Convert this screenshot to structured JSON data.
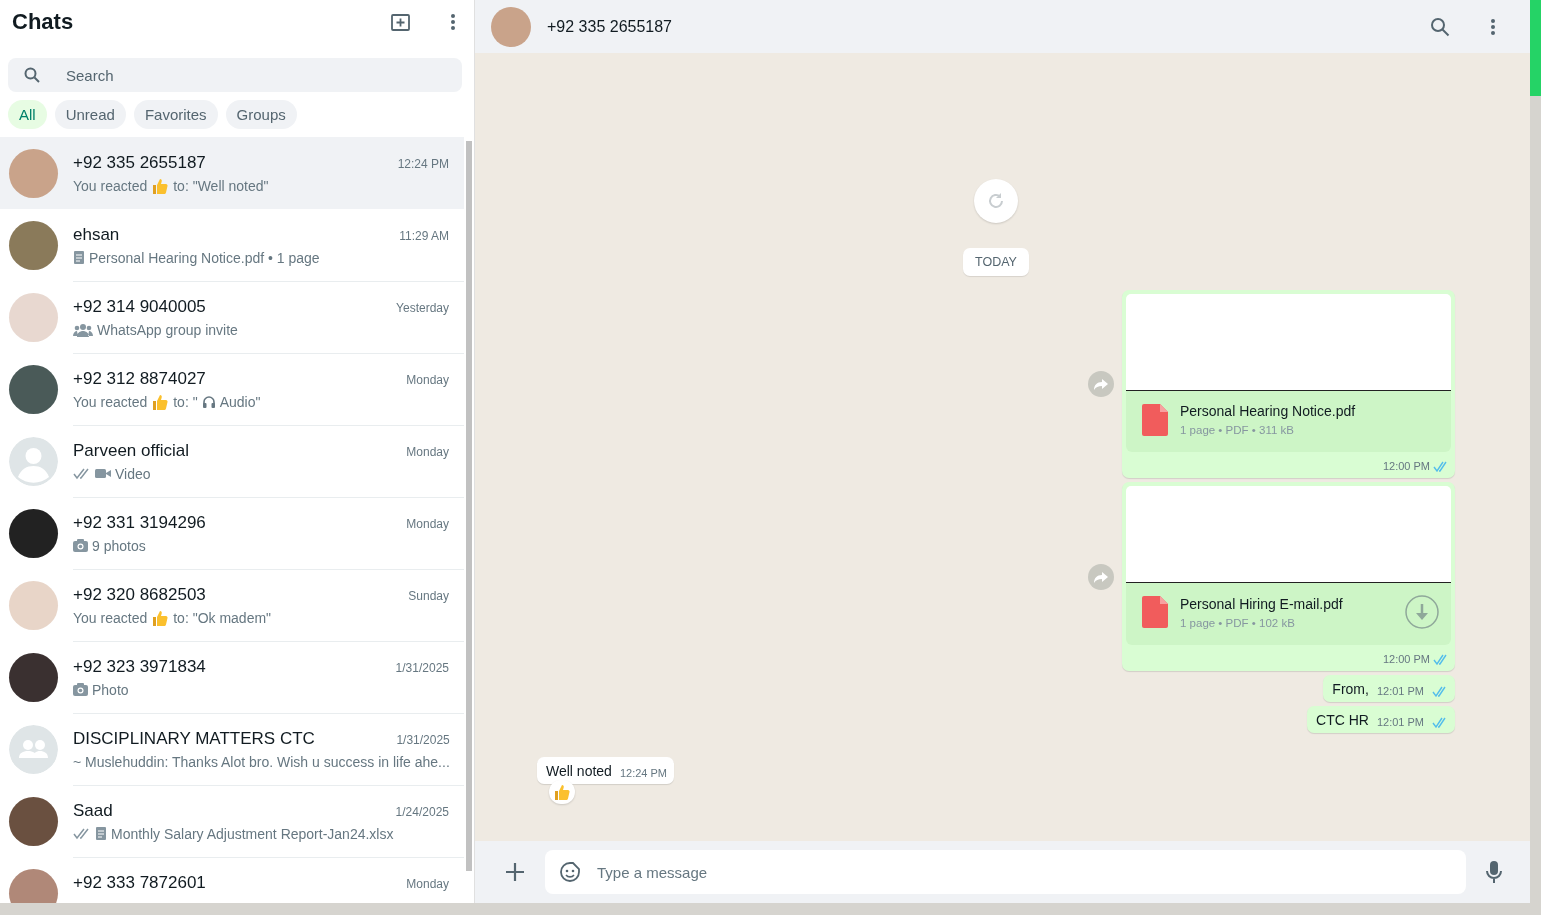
{
  "sidebar": {
    "title": "Chats",
    "search": {
      "placeholder": "Search"
    },
    "filters": [
      {
        "label": "All",
        "selected": true
      },
      {
        "label": "Unread",
        "selected": false
      },
      {
        "label": "Favorites",
        "selected": false
      },
      {
        "label": "Groups",
        "selected": false
      }
    ],
    "chats": [
      {
        "name": "+92 335 2655187",
        "time": "12:24 PM",
        "selected": true,
        "avatar": {
          "kind": "photo"
        },
        "preview": [
          {
            "kind": "text",
            "text": "You reacted"
          },
          {
            "kind": "thumbs"
          },
          {
            "kind": "text",
            "text": "to: \"Well noted\""
          }
        ]
      },
      {
        "name": "ehsan",
        "time": "11:29 AM",
        "selected": false,
        "avatar": {
          "kind": "photo"
        },
        "preview": [
          {
            "kind": "doc"
          },
          {
            "kind": "text",
            "text": "Personal Hearing Notice.pdf • 1 page"
          }
        ]
      },
      {
        "name": "+92 314 9040005",
        "time": "Yesterday",
        "selected": false,
        "avatar": {
          "kind": "photo"
        },
        "preview": [
          {
            "kind": "group"
          },
          {
            "kind": "text",
            "text": "WhatsApp group invite"
          }
        ]
      },
      {
        "name": "+92 312 8874027",
        "time": "Monday",
        "selected": false,
        "avatar": {
          "kind": "photo"
        },
        "preview": [
          {
            "kind": "text",
            "text": "You reacted"
          },
          {
            "kind": "thumbs"
          },
          {
            "kind": "text",
            "text": "to: \""
          },
          {
            "kind": "headphones"
          },
          {
            "kind": "text",
            "text": "Audio\""
          }
        ]
      },
      {
        "name": "Parveen official",
        "time": "Monday",
        "selected": false,
        "avatar": {
          "kind": "default"
        },
        "preview": [
          {
            "kind": "ticks"
          },
          {
            "kind": "video"
          },
          {
            "kind": "text",
            "text": "Video"
          }
        ]
      },
      {
        "name": "+92 331 3194296",
        "time": "Monday",
        "selected": false,
        "avatar": {
          "kind": "photo"
        },
        "preview": [
          {
            "kind": "camera"
          },
          {
            "kind": "text",
            "text": "9 photos"
          }
        ]
      },
      {
        "name": "+92 320 8682503",
        "time": "Sunday",
        "selected": false,
        "avatar": {
          "kind": "photo"
        },
        "preview": [
          {
            "kind": "text",
            "text": "You reacted"
          },
          {
            "kind": "thumbs"
          },
          {
            "kind": "text",
            "text": "to: \"Ok madem\""
          }
        ]
      },
      {
        "name": "+92 323 3971834",
        "time": "1/31/2025",
        "selected": false,
        "avatar": {
          "kind": "photo"
        },
        "preview": [
          {
            "kind": "camera"
          },
          {
            "kind": "text",
            "text": "Photo"
          }
        ]
      },
      {
        "name": "DISCIPLINARY MATTERS CTC",
        "time": "1/31/2025",
        "selected": false,
        "avatar": {
          "kind": "group"
        },
        "preview": [
          {
            "kind": "text",
            "text": "~ Muslehuddin: Thanks Alot bro. Wish u success in life ahe..."
          }
        ]
      },
      {
        "name": "Saad",
        "time": "1/24/2025",
        "selected": false,
        "avatar": {
          "kind": "photo"
        },
        "preview": [
          {
            "kind": "ticks"
          },
          {
            "kind": "doc"
          },
          {
            "kind": "text",
            "text": "Monthly Salary Adjustment Report-Jan24.xlsx"
          }
        ]
      },
      {
        "name": "+92 333 7872601",
        "time": "Monday",
        "selected": false,
        "avatar": {
          "kind": "photo"
        }
      }
    ]
  },
  "conversation": {
    "contact": "+92 335 2655187",
    "day": "TODAY",
    "messages": [
      {
        "kind": "document",
        "file": "Personal Hearing Notice.pdf",
        "meta": "1 page • PDF • 311 kB",
        "time": "12:00 PM",
        "download": false
      },
      {
        "kind": "document",
        "file": "Personal Hiring E-mail.pdf",
        "meta": "1 page • PDF • 102 kB",
        "time": "12:00 PM",
        "download": true
      },
      {
        "kind": "text",
        "outgoing": true,
        "text": "From,",
        "time": "12:01 PM",
        "reaction": false
      },
      {
        "kind": "text",
        "outgoing": true,
        "text": "CTC HR",
        "time": "12:01 PM",
        "reaction": false
      },
      {
        "kind": "text",
        "outgoing": false,
        "text": "Well noted",
        "time": "12:24 PM",
        "reaction": true
      }
    ],
    "composer": {
      "placeholder": "Type a message"
    }
  }
}
